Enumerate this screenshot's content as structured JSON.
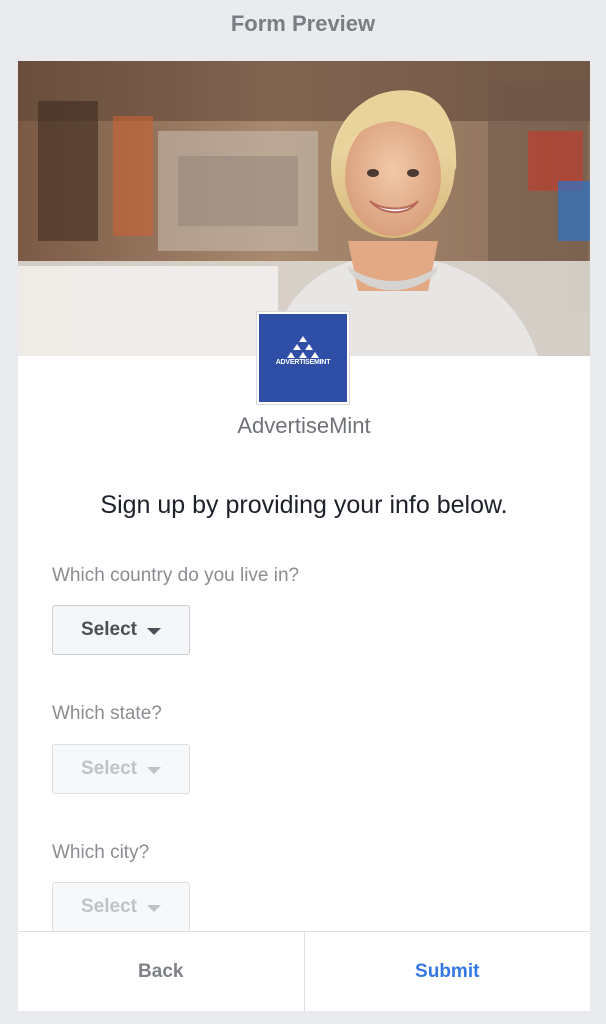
{
  "header": {
    "title": "Form Preview"
  },
  "hero": {
    "image": "woman-smiling-in-cafe-photo"
  },
  "brand": {
    "logo_text": "ADVERTISEMINT",
    "logo_color": "#2f4fa6",
    "name": "AdvertiseMint"
  },
  "form": {
    "headline": "Sign up by providing your info below.",
    "questions": [
      {
        "label": "Which country do you live in?",
        "select": "Select",
        "enabled": true
      },
      {
        "label": "Which state?",
        "select": "Select",
        "enabled": false
      },
      {
        "label": "Which city?",
        "select": "Select",
        "enabled": false
      }
    ]
  },
  "footer": {
    "back": "Back",
    "submit": "Submit",
    "submit_color": "#3578e5"
  }
}
